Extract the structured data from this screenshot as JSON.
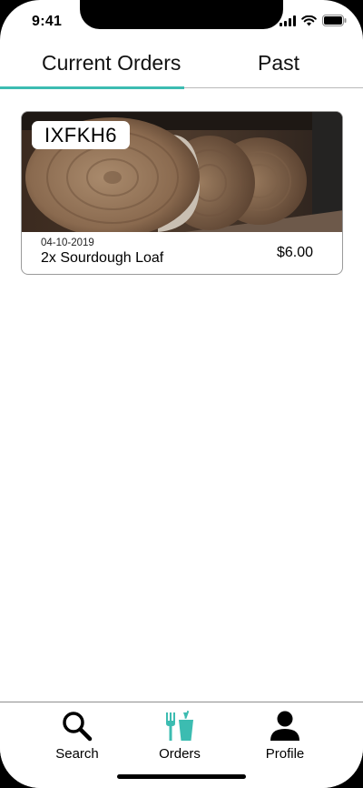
{
  "status_bar": {
    "time": "9:41"
  },
  "tabs": {
    "current_label": "Current Orders",
    "past_label": "Past",
    "active": "current"
  },
  "orders": [
    {
      "code": "IXFKH6",
      "date": "04-10-2019",
      "item": "2x Sourdough Loaf",
      "price": "$6.00",
      "image": "sourdough-loaves-photo"
    }
  ],
  "bottom_nav": {
    "search_label": "Search",
    "orders_label": "Orders",
    "profile_label": "Profile",
    "active": "orders"
  },
  "colors": {
    "accent": "#3cbcb1",
    "text": "#000000",
    "divider": "#b9b9b9"
  },
  "icons": [
    "cellular-signal-icon",
    "wifi-icon",
    "battery-icon",
    "search-icon",
    "fork-cup-icon",
    "person-icon"
  ]
}
